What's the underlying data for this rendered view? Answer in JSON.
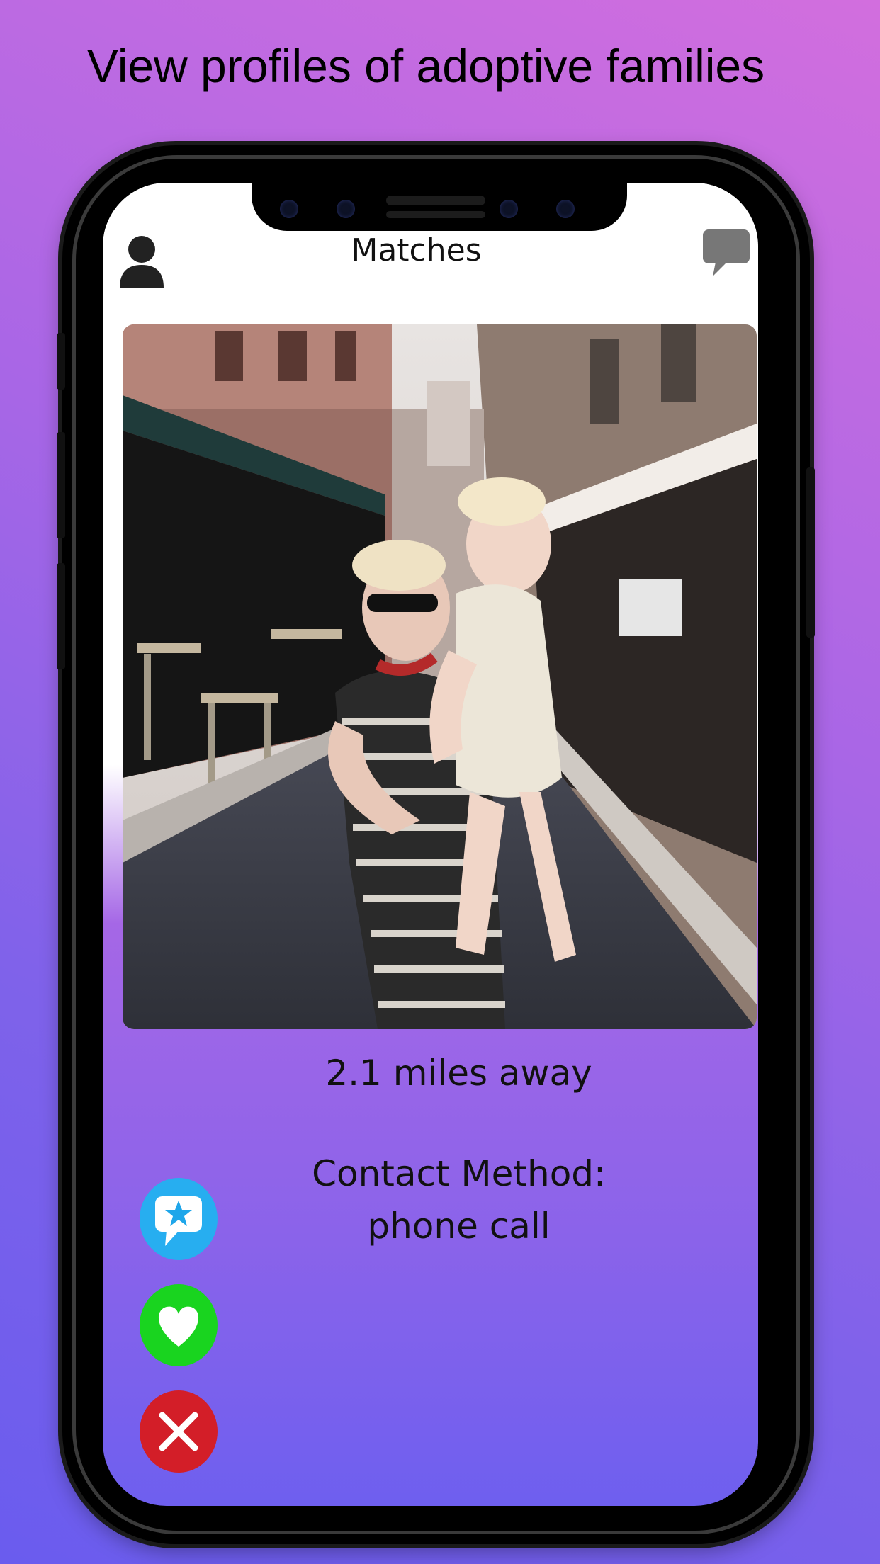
{
  "promo": {
    "title": "View profiles of adoptive families"
  },
  "header": {
    "title": "Matches",
    "profile_icon": "person-icon",
    "chat_icon": "chat-bubble-icon"
  },
  "profile": {
    "photo": "mother-holding-child-street-photo",
    "distance": "2.1 miles away",
    "contact_label": "Contact Method:",
    "contact_value": "phone call"
  },
  "actions": [
    {
      "name": "favorite",
      "icon": "star-message-icon",
      "color": "#27aef0"
    },
    {
      "name": "like",
      "icon": "heart-icon",
      "color": "#19d41f"
    },
    {
      "name": "pass",
      "icon": "close-icon",
      "color": "#d31e28"
    }
  ]
}
